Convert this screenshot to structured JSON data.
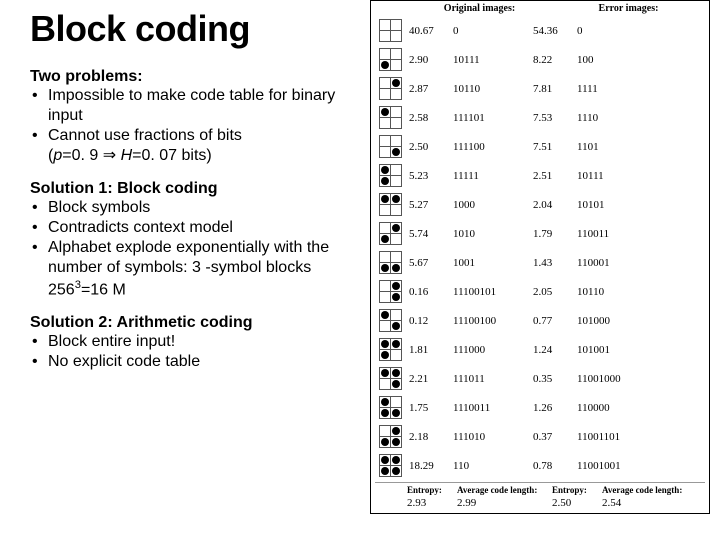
{
  "title": "Block coding",
  "problems": {
    "heading": "Two problems:",
    "items": [
      "Impossible to make code table for binary input",
      "Cannot use fractions of bits"
    ],
    "note_prefix": "(",
    "note_p": "p",
    "note_eq1": "=0. 9  ⇒  ",
    "note_h": "H",
    "note_eq2": "=0. 07 bits)"
  },
  "solution1": {
    "heading": "Solution 1: Block coding",
    "items": [
      "Block symbols",
      "Contradicts context model",
      "Alphabet explode exponentially with the number of symbols: 3 -symbol blocks 256",
      "=16 M"
    ]
  },
  "solution2": {
    "heading": "Solution 2: Arithmetic coding",
    "items": [
      "Block entire input!",
      "No explicit code table"
    ]
  },
  "table": {
    "head1": "Original images:",
    "head2": "Error images:",
    "rows": [
      {
        "dots": [
          0,
          0,
          0,
          0
        ],
        "a": "40.67",
        "b": "0",
        "c": "54.36",
        "d": "0"
      },
      {
        "dots": [
          0,
          0,
          1,
          0
        ],
        "a": "2.90",
        "b": "10111",
        "c": "8.22",
        "d": "100"
      },
      {
        "dots": [
          0,
          1,
          0,
          0
        ],
        "a": "2.87",
        "b": "10110",
        "c": "7.81",
        "d": "1111"
      },
      {
        "dots": [
          1,
          0,
          0,
          0
        ],
        "a": "2.58",
        "b": "111101",
        "c": "7.53",
        "d": "1110"
      },
      {
        "dots": [
          0,
          0,
          0,
          1
        ],
        "a": "2.50",
        "b": "111100",
        "c": "7.51",
        "d": "1101"
      },
      {
        "dots": [
          1,
          0,
          1,
          0
        ],
        "a": "5.23",
        "b": "11111",
        "c": "2.51",
        "d": "10111"
      },
      {
        "dots": [
          1,
          1,
          0,
          0
        ],
        "a": "5.27",
        "b": "1000",
        "c": "2.04",
        "d": "10101"
      },
      {
        "dots": [
          0,
          1,
          1,
          0
        ],
        "a": "5.74",
        "b": "1010",
        "c": "1.79",
        "d": "110011"
      },
      {
        "dots": [
          0,
          0,
          1,
          1
        ],
        "a": "5.67",
        "b": "1001",
        "c": "1.43",
        "d": "110001"
      },
      {
        "dots": [
          0,
          1,
          0,
          1
        ],
        "a": "0.16",
        "b": "11100101",
        "c": "2.05",
        "d": "10110"
      },
      {
        "dots": [
          1,
          0,
          0,
          1
        ],
        "a": "0.12",
        "b": "11100100",
        "c": "0.77",
        "d": "101000"
      },
      {
        "dots": [
          1,
          1,
          1,
          0
        ],
        "a": "1.81",
        "b": "111000",
        "c": "1.24",
        "d": "101001"
      },
      {
        "dots": [
          1,
          1,
          0,
          1
        ],
        "a": "2.21",
        "b": "111011",
        "c": "0.35",
        "d": "11001000"
      },
      {
        "dots": [
          1,
          0,
          1,
          1
        ],
        "a": "1.75",
        "b": "1110011",
        "c": "1.26",
        "d": "110000"
      },
      {
        "dots": [
          0,
          1,
          1,
          1
        ],
        "a": "2.18",
        "b": "111010",
        "c": "0.37",
        "d": "11001101"
      },
      {
        "dots": [
          1,
          1,
          1,
          1
        ],
        "a": "18.29",
        "b": "110",
        "c": "0.78",
        "d": "11001001"
      }
    ],
    "footer": {
      "label_e": "Entropy:",
      "label_a": "Average code length:",
      "e1": "2.93",
      "a1": "2.99",
      "e2": "2.50",
      "a2": "2.54"
    }
  }
}
